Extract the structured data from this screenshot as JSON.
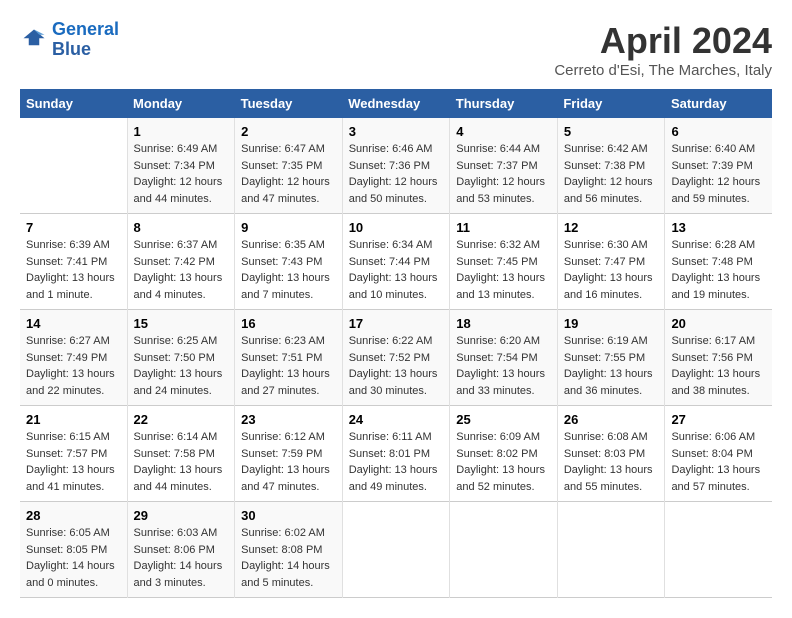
{
  "logo": {
    "line1": "General",
    "line2": "Blue"
  },
  "title": "April 2024",
  "subtitle": "Cerreto d'Esi, The Marches, Italy",
  "weekdays": [
    "Sunday",
    "Monday",
    "Tuesday",
    "Wednesday",
    "Thursday",
    "Friday",
    "Saturday"
  ],
  "weeks": [
    [
      {
        "day": "",
        "content": ""
      },
      {
        "day": "1",
        "content": "Sunrise: 6:49 AM\nSunset: 7:34 PM\nDaylight: 12 hours\nand 44 minutes."
      },
      {
        "day": "2",
        "content": "Sunrise: 6:47 AM\nSunset: 7:35 PM\nDaylight: 12 hours\nand 47 minutes."
      },
      {
        "day": "3",
        "content": "Sunrise: 6:46 AM\nSunset: 7:36 PM\nDaylight: 12 hours\nand 50 minutes."
      },
      {
        "day": "4",
        "content": "Sunrise: 6:44 AM\nSunset: 7:37 PM\nDaylight: 12 hours\nand 53 minutes."
      },
      {
        "day": "5",
        "content": "Sunrise: 6:42 AM\nSunset: 7:38 PM\nDaylight: 12 hours\nand 56 minutes."
      },
      {
        "day": "6",
        "content": "Sunrise: 6:40 AM\nSunset: 7:39 PM\nDaylight: 12 hours\nand 59 minutes."
      }
    ],
    [
      {
        "day": "7",
        "content": "Sunrise: 6:39 AM\nSunset: 7:41 PM\nDaylight: 13 hours\nand 1 minute."
      },
      {
        "day": "8",
        "content": "Sunrise: 6:37 AM\nSunset: 7:42 PM\nDaylight: 13 hours\nand 4 minutes."
      },
      {
        "day": "9",
        "content": "Sunrise: 6:35 AM\nSunset: 7:43 PM\nDaylight: 13 hours\nand 7 minutes."
      },
      {
        "day": "10",
        "content": "Sunrise: 6:34 AM\nSunset: 7:44 PM\nDaylight: 13 hours\nand 10 minutes."
      },
      {
        "day": "11",
        "content": "Sunrise: 6:32 AM\nSunset: 7:45 PM\nDaylight: 13 hours\nand 13 minutes."
      },
      {
        "day": "12",
        "content": "Sunrise: 6:30 AM\nSunset: 7:47 PM\nDaylight: 13 hours\nand 16 minutes."
      },
      {
        "day": "13",
        "content": "Sunrise: 6:28 AM\nSunset: 7:48 PM\nDaylight: 13 hours\nand 19 minutes."
      }
    ],
    [
      {
        "day": "14",
        "content": "Sunrise: 6:27 AM\nSunset: 7:49 PM\nDaylight: 13 hours\nand 22 minutes."
      },
      {
        "day": "15",
        "content": "Sunrise: 6:25 AM\nSunset: 7:50 PM\nDaylight: 13 hours\nand 24 minutes."
      },
      {
        "day": "16",
        "content": "Sunrise: 6:23 AM\nSunset: 7:51 PM\nDaylight: 13 hours\nand 27 minutes."
      },
      {
        "day": "17",
        "content": "Sunrise: 6:22 AM\nSunset: 7:52 PM\nDaylight: 13 hours\nand 30 minutes."
      },
      {
        "day": "18",
        "content": "Sunrise: 6:20 AM\nSunset: 7:54 PM\nDaylight: 13 hours\nand 33 minutes."
      },
      {
        "day": "19",
        "content": "Sunrise: 6:19 AM\nSunset: 7:55 PM\nDaylight: 13 hours\nand 36 minutes."
      },
      {
        "day": "20",
        "content": "Sunrise: 6:17 AM\nSunset: 7:56 PM\nDaylight: 13 hours\nand 38 minutes."
      }
    ],
    [
      {
        "day": "21",
        "content": "Sunrise: 6:15 AM\nSunset: 7:57 PM\nDaylight: 13 hours\nand 41 minutes."
      },
      {
        "day": "22",
        "content": "Sunrise: 6:14 AM\nSunset: 7:58 PM\nDaylight: 13 hours\nand 44 minutes."
      },
      {
        "day": "23",
        "content": "Sunrise: 6:12 AM\nSunset: 7:59 PM\nDaylight: 13 hours\nand 47 minutes."
      },
      {
        "day": "24",
        "content": "Sunrise: 6:11 AM\nSunset: 8:01 PM\nDaylight: 13 hours\nand 49 minutes."
      },
      {
        "day": "25",
        "content": "Sunrise: 6:09 AM\nSunset: 8:02 PM\nDaylight: 13 hours\nand 52 minutes."
      },
      {
        "day": "26",
        "content": "Sunrise: 6:08 AM\nSunset: 8:03 PM\nDaylight: 13 hours\nand 55 minutes."
      },
      {
        "day": "27",
        "content": "Sunrise: 6:06 AM\nSunset: 8:04 PM\nDaylight: 13 hours\nand 57 minutes."
      }
    ],
    [
      {
        "day": "28",
        "content": "Sunrise: 6:05 AM\nSunset: 8:05 PM\nDaylight: 14 hours\nand 0 minutes."
      },
      {
        "day": "29",
        "content": "Sunrise: 6:03 AM\nSunset: 8:06 PM\nDaylight: 14 hours\nand 3 minutes."
      },
      {
        "day": "30",
        "content": "Sunrise: 6:02 AM\nSunset: 8:08 PM\nDaylight: 14 hours\nand 5 minutes."
      },
      {
        "day": "",
        "content": ""
      },
      {
        "day": "",
        "content": ""
      },
      {
        "day": "",
        "content": ""
      },
      {
        "day": "",
        "content": ""
      }
    ]
  ]
}
